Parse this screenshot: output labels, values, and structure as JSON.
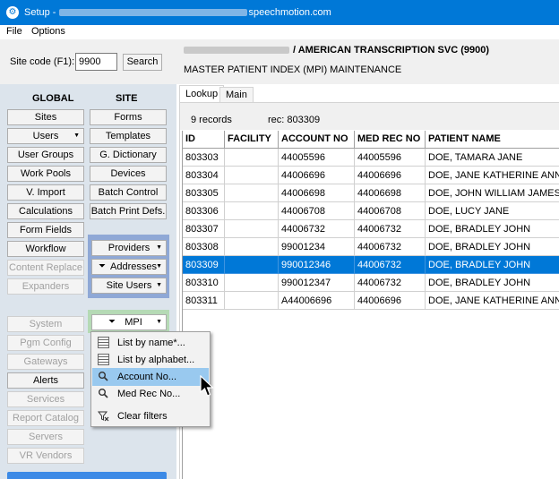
{
  "window": {
    "title_prefix": "Setup -",
    "title_suffix": "speechmotion.com",
    "icon": "settings-app-icon"
  },
  "menu": [
    "File",
    "Options"
  ],
  "site_code": {
    "label": "Site code (F1):",
    "value": "9900",
    "search_label": "Search"
  },
  "sections": {
    "global": "GLOBAL",
    "site": "SITE"
  },
  "global_buttons": [
    {
      "label": "Sites",
      "enabled": true
    },
    {
      "label": "Users",
      "enabled": true,
      "dropdown": true
    },
    {
      "label": "User Groups",
      "enabled": true
    },
    {
      "label": "Work Pools",
      "enabled": true
    },
    {
      "label": "V. Import",
      "enabled": true
    },
    {
      "label": "Calculations",
      "enabled": true
    },
    {
      "label": "Form Fields",
      "enabled": true
    },
    {
      "label": "Workflow",
      "enabled": true
    },
    {
      "label": "Content Replace",
      "enabled": false
    },
    {
      "label": "Expanders",
      "enabled": false
    },
    {
      "label": "System",
      "enabled": false
    },
    {
      "label": "Pgm Config",
      "enabled": false
    },
    {
      "label": "Gateways",
      "enabled": false
    },
    {
      "label": "Alerts",
      "enabled": true
    },
    {
      "label": "Services",
      "enabled": false
    },
    {
      "label": "Report Catalog",
      "enabled": false
    },
    {
      "label": "Servers",
      "enabled": false
    },
    {
      "label": "VR Vendors",
      "enabled": false
    }
  ],
  "site_buttons": [
    {
      "label": "Forms"
    },
    {
      "label": "Templates"
    },
    {
      "label": "G. Dictionary"
    },
    {
      "label": "Devices"
    },
    {
      "label": "Batch Control"
    },
    {
      "label": "Batch Print Defs."
    },
    {
      "label": "Providers",
      "dropdown": true
    },
    {
      "label": "Addresses",
      "dropdown": true,
      "filter": true
    },
    {
      "label": "Site Users",
      "dropdown": true
    },
    {
      "label": "MPI",
      "dropdown": true,
      "filter": true
    }
  ],
  "header": {
    "org": "/ AMERICAN TRANSCRIPTION SVC (9900)",
    "subtitle": "MASTER PATIENT INDEX (MPI) MAINTENANCE"
  },
  "tabs": [
    {
      "label": "Lookup",
      "active": true
    },
    {
      "label": "Main",
      "active": false
    }
  ],
  "info": {
    "records": "9 records",
    "rec": "rec: 803309"
  },
  "table": {
    "columns": [
      "ID",
      "FACILITY",
      "ACCOUNT NO",
      "MED REC NO",
      "PATIENT NAME"
    ],
    "rows": [
      {
        "id": "803303",
        "facility": "",
        "account": "44005596",
        "medrec": "44005596",
        "name": "DOE, TAMARA JANE"
      },
      {
        "id": "803304",
        "facility": "",
        "account": "44006696",
        "medrec": "44006696",
        "name": "DOE, JANE KATHERINE ANNE"
      },
      {
        "id": "803305",
        "facility": "",
        "account": "44006698",
        "medrec": "44006698",
        "name": "DOE, JOHN WILLIAM JAMES"
      },
      {
        "id": "803306",
        "facility": "",
        "account": "44006708",
        "medrec": "44006708",
        "name": "DOE, LUCY JANE"
      },
      {
        "id": "803307",
        "facility": "",
        "account": "44006732",
        "medrec": "44006732",
        "name": "DOE, BRADLEY JOHN"
      },
      {
        "id": "803308",
        "facility": "",
        "account": "99001234",
        "medrec": "44006732",
        "name": "DOE, BRADLEY JOHN"
      },
      {
        "id": "803309",
        "facility": "",
        "account": "990012346",
        "medrec": "44006732",
        "name": "DOE, BRADLEY JOHN"
      },
      {
        "id": "803310",
        "facility": "",
        "account": "990012347",
        "medrec": "44006732",
        "name": "DOE, BRADLEY JOHN"
      },
      {
        "id": "803311",
        "facility": "",
        "account": "A44006696",
        "medrec": "44006696",
        "name": "DOE, JANE KATHERINE ANNE"
      }
    ],
    "selected_index": 6
  },
  "mpi_menu": [
    {
      "label": "List by name*...",
      "icon": "list-grid-icon"
    },
    {
      "label": "List by alphabet...",
      "icon": "list-grid-icon"
    },
    {
      "label": "Account No...",
      "icon": "magnifier-icon",
      "highlighted": true
    },
    {
      "label": "Med Rec No...",
      "icon": "magnifier-icon"
    },
    {
      "label": "Clear filters",
      "icon": "clear-filter-icon"
    }
  ],
  "colors": {
    "titlebar": "#0078d7",
    "selection": "#0078d7",
    "menu_highlight": "#99c9ef",
    "group_blue": "#8fa8d6",
    "group_green": "#b5dab5"
  }
}
